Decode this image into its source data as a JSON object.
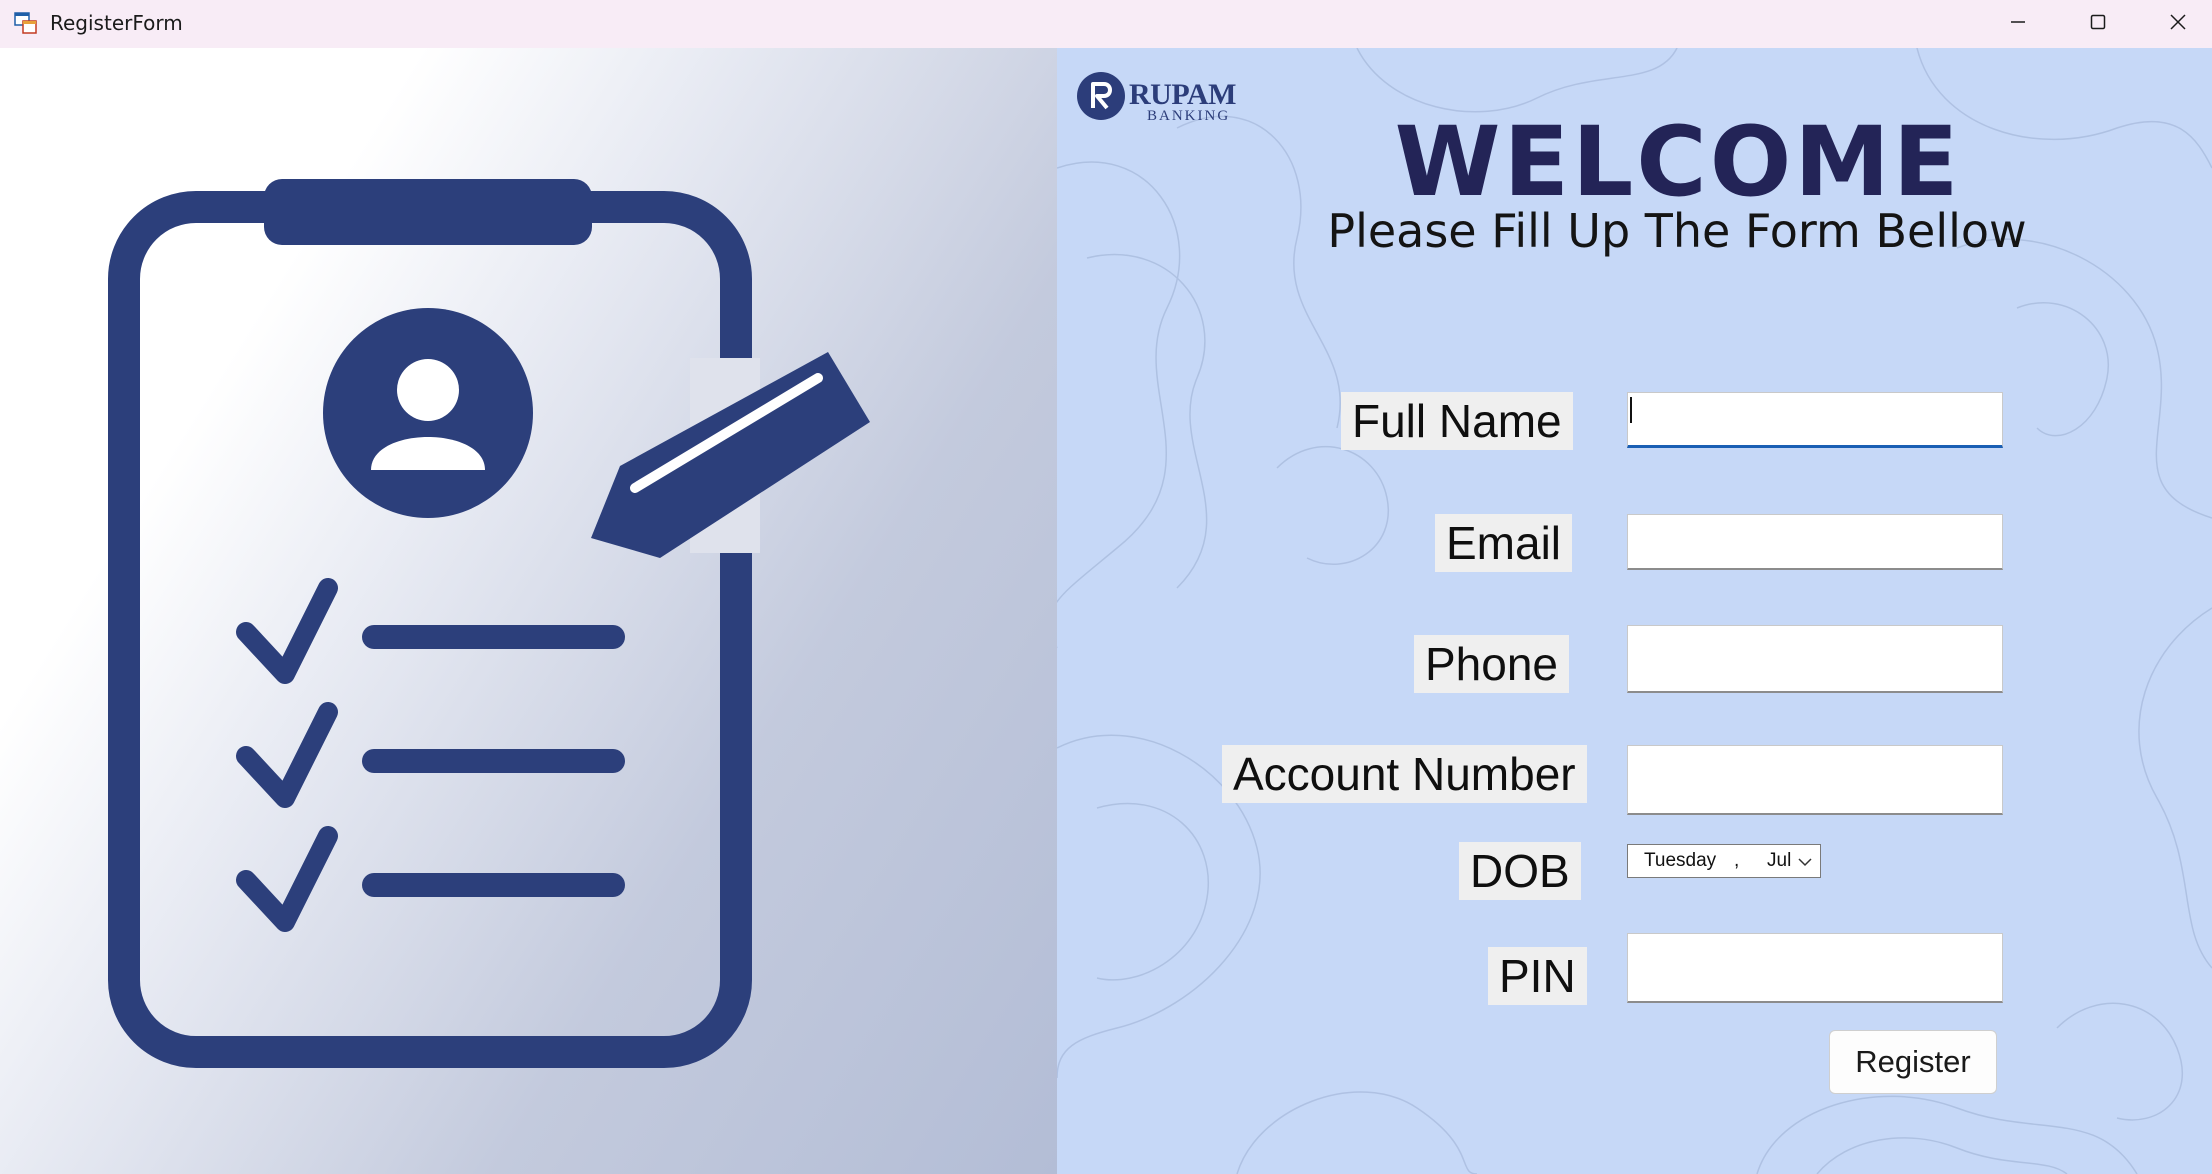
{
  "window": {
    "title": "RegisterForm",
    "controls": [
      "minimize-icon",
      "maximize-icon",
      "close-icon"
    ]
  },
  "logo": {
    "brand": "RUPAM",
    "tagline": "BANKING",
    "icon": "letter-r-circle-icon"
  },
  "header": {
    "welcome": "WELCOME",
    "subtitle": "Please Fill Up The Form Bellow"
  },
  "illustration": {
    "icon": "clipboard-registration-icon",
    "parts": [
      "user-avatar-icon",
      "pencil-icon",
      "checkmark-icon",
      "checkmark-icon",
      "checkmark-icon"
    ]
  },
  "form": {
    "full_name": {
      "label": "Full Name",
      "value": ""
    },
    "email": {
      "label": "Email",
      "value": ""
    },
    "phone": {
      "label": "Phone",
      "value": ""
    },
    "account_number": {
      "label": "Account Number",
      "value": ""
    },
    "dob": {
      "label": "DOB",
      "day": "Tuesday",
      "separator": ",",
      "month": "Jul"
    },
    "pin": {
      "label": "PIN",
      "value": ""
    },
    "register_label": "Register"
  },
  "colors": {
    "brand_navy": "#2c3f7b",
    "welcome_text": "#232457",
    "form_background": "#c6d8f7",
    "input_focus": "#1a5fb4"
  }
}
